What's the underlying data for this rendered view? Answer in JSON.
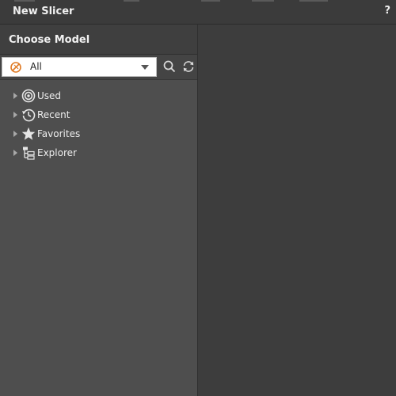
{
  "window": {
    "title": "New Slicer",
    "help_label": "?"
  },
  "panel": {
    "title": "Choose Model",
    "filter": {
      "value": "All",
      "icon": "no-filter-icon"
    },
    "search_icon": "search-icon",
    "refresh_icon": "refresh-icon"
  },
  "tree": {
    "items": [
      {
        "label": "Used",
        "icon": "target-icon"
      },
      {
        "label": "Recent",
        "icon": "history-icon"
      },
      {
        "label": "Favorites",
        "icon": "star-icon"
      },
      {
        "label": "Explorer",
        "icon": "folder-tree-icon"
      }
    ]
  },
  "colors": {
    "background": "#3d3d3d",
    "panel": "#4e4e4e",
    "accent_orange": "#e07b25",
    "text": "#eeeeee"
  }
}
